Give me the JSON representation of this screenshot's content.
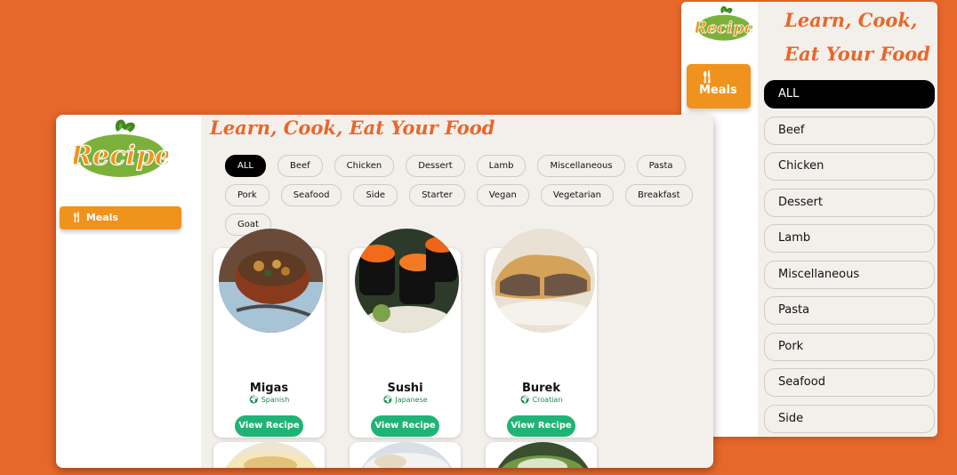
{
  "mobile": {
    "logo_text": "Recipe",
    "title": "Learn, Cook, Eat Your Food",
    "nav": {
      "meals_label": "Meals",
      "meals_icon": "fork-knife-icon"
    },
    "categories": [
      "ALL",
      "Beef",
      "Chicken",
      "Dessert",
      "Lamb",
      "Miscellaneous",
      "Pasta",
      "Pork",
      "Seafood",
      "Side"
    ],
    "active_category": "ALL"
  },
  "desktop": {
    "logo_text": "Recipe",
    "title": "Learn, Cook, Eat Your Food",
    "nav": {
      "meals_label": "Meals",
      "meals_icon": "fork-knife-icon"
    },
    "categories": [
      "ALL",
      "Beef",
      "Chicken",
      "Dessert",
      "Lamb",
      "Miscellaneous",
      "Pasta",
      "Pork",
      "Seafood",
      "Side",
      "Starter",
      "Vegan",
      "Vegetarian",
      "Breakfast",
      "Goat"
    ],
    "active_category": "ALL",
    "meals": [
      {
        "name": "Migas",
        "area": "Spanish",
        "button": "View Recipe"
      },
      {
        "name": "Sushi",
        "area": "Japanese",
        "button": "View Recipe"
      },
      {
        "name": "Burek",
        "area": "Croatian",
        "button": "View Recipe"
      }
    ]
  },
  "colors": {
    "background": "#e8672a",
    "accent": "#f0931e",
    "button": "#1fb476",
    "area_text": "#1a8a4a"
  }
}
